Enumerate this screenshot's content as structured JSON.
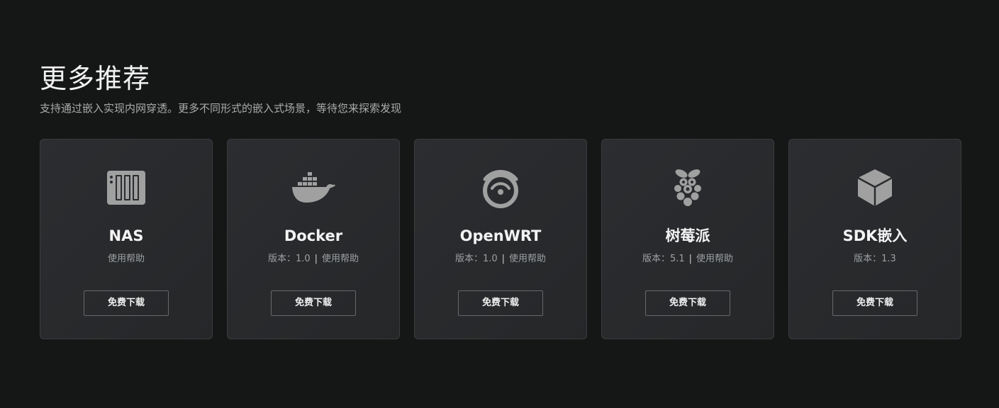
{
  "header": {
    "title": "更多推荐",
    "subtitle": "支持通过嵌入实现内网穿透。更多不同形式的嵌入式场景，等待您来探索发现"
  },
  "colors": {
    "background": "#151716",
    "card": "#2b2d30",
    "icon": "#a0a0a0"
  },
  "cards": [
    {
      "name": "NAS",
      "icon": "nas-icon",
      "version": "",
      "help": "使用帮助",
      "button": "免费下载"
    },
    {
      "name": "Docker",
      "icon": "docker-icon",
      "version": "版本：1.0",
      "separator": "|",
      "help": "使用帮助",
      "button": "免费下载"
    },
    {
      "name": "OpenWRT",
      "icon": "openwrt-icon",
      "version": "版本：1.0",
      "separator": "|",
      "help": "使用帮助",
      "button": "免费下载"
    },
    {
      "name": "树莓派",
      "icon": "raspberry-pi-icon",
      "version": "版本：5.1",
      "separator": "|",
      "help": "使用帮助",
      "button": "免费下载"
    },
    {
      "name": "SDK嵌入",
      "icon": "cube-icon",
      "version": "版本：1.3",
      "help": "",
      "button": "免费下载"
    }
  ]
}
